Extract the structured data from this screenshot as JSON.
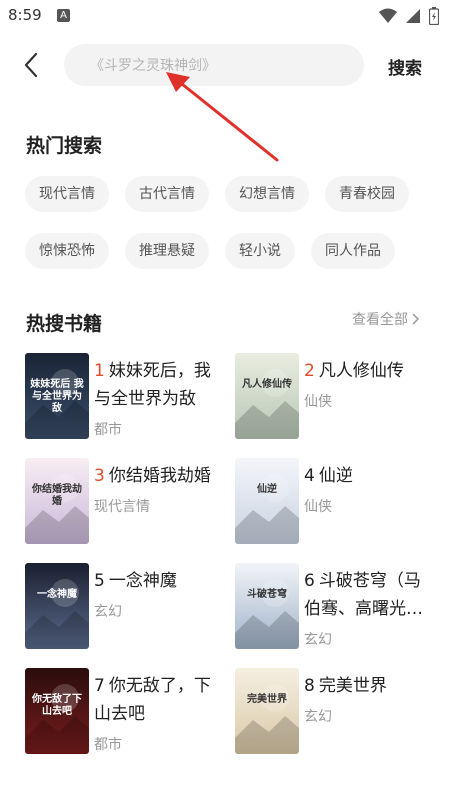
{
  "status_bar": {
    "time": "8:59",
    "notif_letter": "A"
  },
  "header": {
    "search_placeholder": "《斗罗之灵珠神剑》",
    "search_button": "搜索"
  },
  "hot_search": {
    "title": "热门搜索",
    "tags": [
      "现代言情",
      "古代言情",
      "幻想言情",
      "青春校园",
      "惊悚恐怖",
      "推理悬疑",
      "轻小说",
      "同人作品"
    ]
  },
  "hot_books": {
    "title": "热搜书籍",
    "see_all": "查看全部",
    "items": [
      {
        "rank": "1",
        "title": "妹妹死后，我与全世界为敌",
        "category": "都市",
        "cover_text": "妹妹死后 我与全世界为敌",
        "cover_colors": [
          "#1a2436",
          "#3a4e6a"
        ]
      },
      {
        "rank": "2",
        "title": "凡人修仙传",
        "category": "仙侠",
        "cover_text": "凡人修仙传",
        "cover_colors": [
          "#e9ecdf",
          "#b7c7b6"
        ]
      },
      {
        "rank": "3",
        "title": "你结婚我劫婚",
        "category": "现代言情",
        "cover_text": "你结婚我劫婚",
        "cover_colors": [
          "#f7eef2",
          "#c9b7d9"
        ]
      },
      {
        "rank": "4",
        "title": "仙逆",
        "category": "仙侠",
        "cover_text": "仙逆",
        "cover_colors": [
          "#f4f5f8",
          "#c8d2e2"
        ]
      },
      {
        "rank": "5",
        "title": "一念神魔",
        "category": "玄幻",
        "cover_text": "一念神魔",
        "cover_colors": [
          "#1b2030",
          "#5a6a8c"
        ]
      },
      {
        "rank": "6",
        "title": "斗破苍穹（马伯骞、高曙光主演）",
        "category": "玄幻",
        "cover_text": "斗破苍穹",
        "cover_colors": [
          "#f2f4f7",
          "#9fb2c9"
        ]
      },
      {
        "rank": "7",
        "title": "你无敌了，下山去吧",
        "category": "都市",
        "cover_text": "你无敌了下山去吧",
        "cover_colors": [
          "#2a0d0d",
          "#7a1c1c"
        ]
      },
      {
        "rank": "8",
        "title": "完美世界",
        "category": "玄幻",
        "cover_text": "完美世界",
        "cover_colors": [
          "#f5efe2",
          "#d9c8a6"
        ]
      }
    ]
  },
  "colors": {
    "accent_rank": "#e34b2a",
    "annotation_arrow": "#e0302a"
  }
}
